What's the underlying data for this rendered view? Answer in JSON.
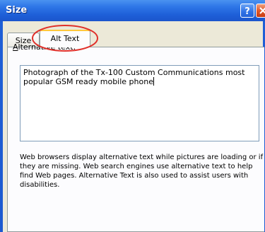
{
  "window": {
    "title": "Size",
    "help_label": "?",
    "close_label": "X"
  },
  "tabs": [
    {
      "label": "Size",
      "selected": false
    },
    {
      "label": "Alt Text",
      "selected": true
    }
  ],
  "alt_text": {
    "label_mnemonic": "A",
    "label_rest": "lternative text:",
    "value": "Photograph of the Tx-100 Custom Communications most popular GSM ready mobile phone",
    "description": "Web browsers display alternative text while pictures are loading or if they are missing.  Web search engines use alternative text to help find Web pages.  Alternative Text is also used to assist users with disabilities."
  },
  "colors": {
    "titlebar": "#1e5fd8",
    "client": "#ece9d8",
    "annotation": "#e0302a"
  }
}
